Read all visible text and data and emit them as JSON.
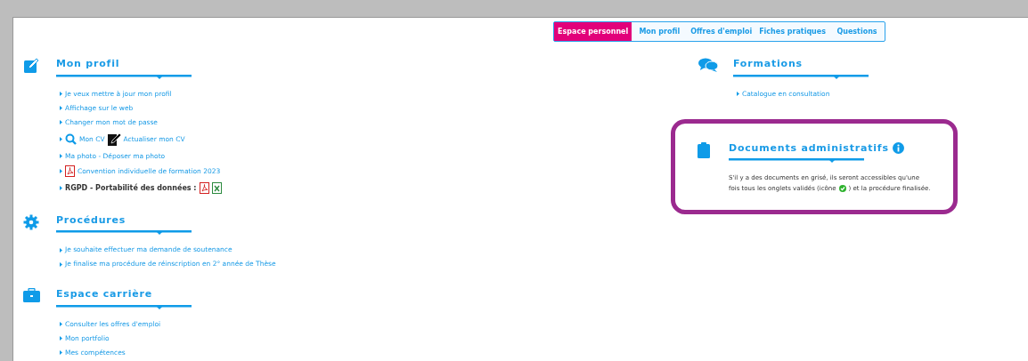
{
  "tabs": [
    {
      "label": "Espace personnel",
      "selected": true
    },
    {
      "label": "Mon profil",
      "selected": false
    },
    {
      "label": "Offres d'emploi",
      "selected": false
    },
    {
      "label": "Fiches pratiques",
      "selected": false
    },
    {
      "label": "Questions",
      "selected": false
    }
  ],
  "left_sections": [
    {
      "title": "Mon profil",
      "items": [
        {
          "kind": "link",
          "text": "Je veux mettre à jour mon profil"
        },
        {
          "kind": "link",
          "text": "Affichage sur le web"
        },
        {
          "kind": "link",
          "text": "Changer mon mot de passe"
        },
        {
          "kind": "cv",
          "text": "Mon CV",
          "text2": "Actualiser mon CV"
        },
        {
          "kind": "link",
          "text": "Ma photo - Déposer ma photo"
        },
        {
          "kind": "pdf",
          "text": "Convention individuelle de formation 2023"
        },
        {
          "kind": "export",
          "text": "RGPD - Portabilité des données :"
        }
      ]
    },
    {
      "title": "Procédures",
      "items": [
        {
          "kind": "link",
          "text": "Je souhaite effectuer ma demande de soutenance"
        },
        {
          "kind": "link",
          "text": "Je finalise ma procédure de réinscription en 2° année de Thèse"
        }
      ]
    },
    {
      "title": "Espace carrière",
      "items": [
        {
          "kind": "link",
          "text": "Consulter les offres d'emploi"
        },
        {
          "kind": "link",
          "text": "Mon portfolio"
        },
        {
          "kind": "link",
          "text": "Mes compétences"
        }
      ]
    }
  ],
  "right_sections": [
    {
      "title": "Formations",
      "highlighted": false,
      "info": false,
      "items": [
        {
          "kind": "link",
          "text": "Catalogue en consultation"
        }
      ]
    },
    {
      "title": "Documents administratifs",
      "highlighted": true,
      "info": true,
      "note": {
        "line1": "S'il y a des documents en grisé, ils seront accessibles qu'une",
        "before": "fois tous les onglets validés (icône",
        "after": ") et la procédure finalisée."
      }
    }
  ]
}
